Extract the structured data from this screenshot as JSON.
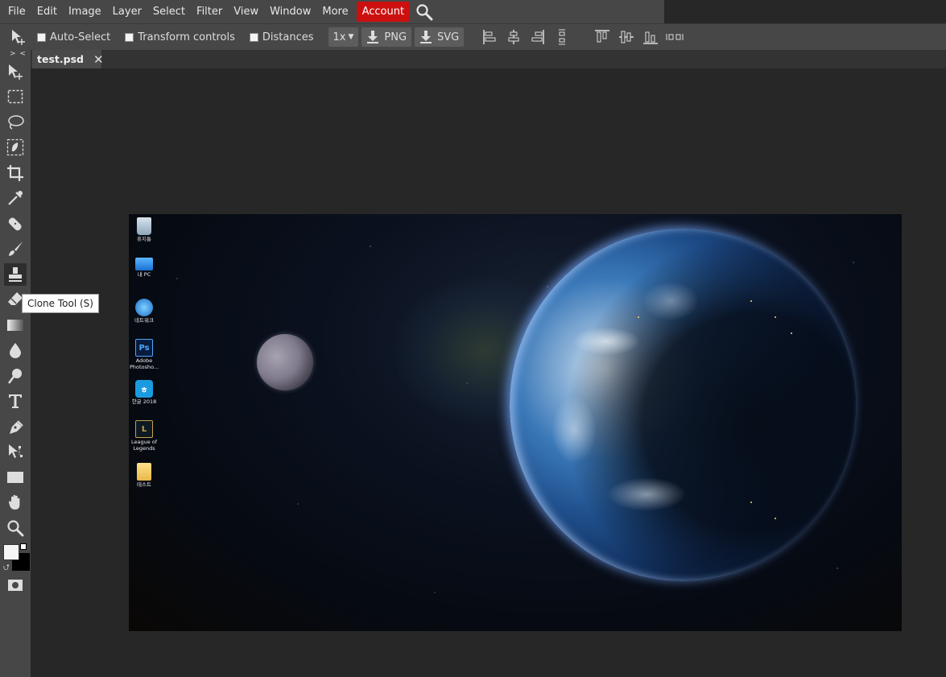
{
  "menu": {
    "items": [
      "File",
      "Edit",
      "Image",
      "Layer",
      "Select",
      "Filter",
      "View",
      "Window",
      "More"
    ],
    "account": "Account"
  },
  "options": {
    "auto_select": "Auto-Select",
    "transform_controls": "Transform controls",
    "distances": "Distances",
    "zoom": "1x",
    "png": "PNG",
    "svg": "SVG"
  },
  "tab": {
    "name": "test.psd",
    "close": "✕"
  },
  "toolbar": {
    "collapse": "> <",
    "tooltip": "Clone Tool (S)",
    "tools": [
      "move",
      "marquee",
      "lasso",
      "quick-select",
      "crop",
      "eyedropper",
      "healing",
      "brush",
      "clone-stamp",
      "eraser",
      "gradient",
      "blur",
      "dodge",
      "type",
      "pen",
      "path-select",
      "rectangle",
      "hand",
      "zoom"
    ],
    "active_tool": "clone-stamp"
  },
  "colors": {
    "foreground": "#ffffff",
    "background": "#000000",
    "accent": "#cc1010"
  },
  "desktop_icons": [
    {
      "label": "휴지통",
      "icon": "recycle-bin-icon"
    },
    {
      "label": "내 PC",
      "icon": "computer-icon"
    },
    {
      "label": "네트워크",
      "icon": "network-icon"
    },
    {
      "label": "Adobe Photosho...",
      "icon": "photoshop-icon"
    },
    {
      "label": "한글 2018",
      "icon": "hangul-icon"
    },
    {
      "label": "League of Legends",
      "icon": "league-of-legends-icon"
    },
    {
      "label": "테스트",
      "icon": "folder-icon"
    }
  ]
}
